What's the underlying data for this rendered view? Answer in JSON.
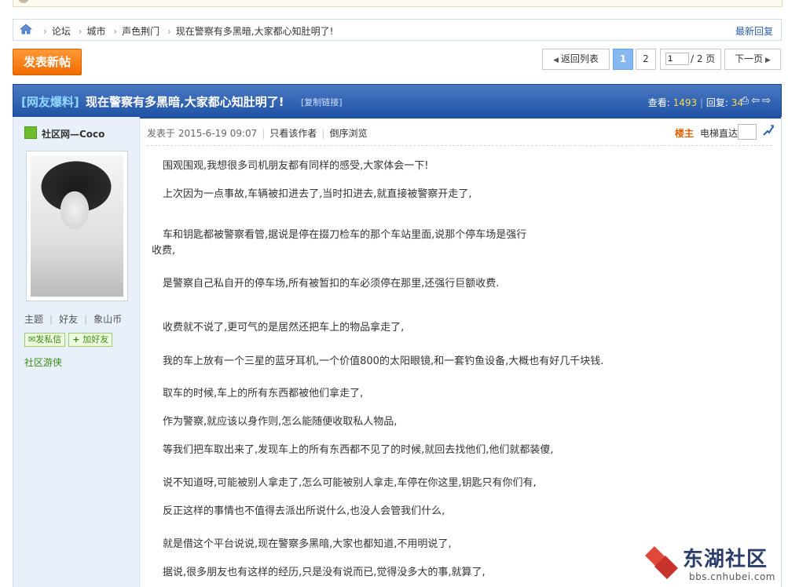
{
  "breadcrumb": {
    "items": [
      "论坛",
      "城市",
      "声色荆门",
      "现在警察有多黑暗,大家都心知肚明了!"
    ],
    "newest_reply": "最新回复"
  },
  "toolbar": {
    "post_button": "发表新帖",
    "back_to_list": "返回列表",
    "pages": [
      "1",
      "2"
    ],
    "current_page": "1",
    "jump_value": "1",
    "total_pages": "/ 2 页",
    "next_page": "下一页"
  },
  "thread": {
    "category": "[网友爆料]",
    "title": "现在警察有多黑暗,大家都心知肚明了!",
    "copy_link": "[复制链接]",
    "views_label": "查看:",
    "views": "1493",
    "replies_label": "回复:",
    "replies": "34"
  },
  "author": {
    "name": "社区网—Coco",
    "stats": [
      "主题",
      "好友",
      "象山币"
    ],
    "pm_button": "发私信",
    "add_friend_button": "加好友",
    "rank": "社区游侠"
  },
  "post": {
    "posted_at": "发表于 2015-6-19 09:07",
    "only_author": "只看该作者",
    "reverse": "倒序浏览",
    "floor": "楼主",
    "elevator": "电梯直达",
    "paragraphs": [
      "围观围观,我想很多司机朋友都有同样的感受,大家体会一下!",
      "上次因为一点事故,车辆被扣进去了,当时扣进去,就直接被警察开走了,",
      "车和钥匙都被警察看管,据说是停在掇刀检车的那个车站里面,说那个停车场是强行",
      "收费,",
      "是警察自己私自开的停车场,所有被暂扣的车必须停在那里,还强行巨额收费.",
      "收费就不说了,更可气的是居然还把车上的物品拿走了,",
      "我的车上放有一个三星的蓝牙耳机,一个价值800的太阳眼镜,和一套钓鱼设备,大概也有好几千块钱.",
      "取车的时候,车上的所有东西都被他们拿走了,",
      "作为警察,就应该以身作则,怎么能随便收取私人物品,",
      "等我们把车取出来了,发现车上的所有东西都不见了的时候,就回去找他们,他们就都装傻,",
      "说不知道呀,可能被别人拿走了,怎么可能被别人拿走,车停在你这里,钥匙只有你们有,",
      "反正这样的事情也不值得去派出所说什么,也没人会管我们什么,",
      "就是借这个平台说说,现在警察多黑暗,大家也都知道,不用明说了,",
      "据说,很多朋友也有这样的经历,只是没有说而已,觉得没多大的事,就算了,"
    ]
  },
  "watermark": {
    "text": "东湖社区",
    "url": "bbs.cnhubei.com"
  }
}
